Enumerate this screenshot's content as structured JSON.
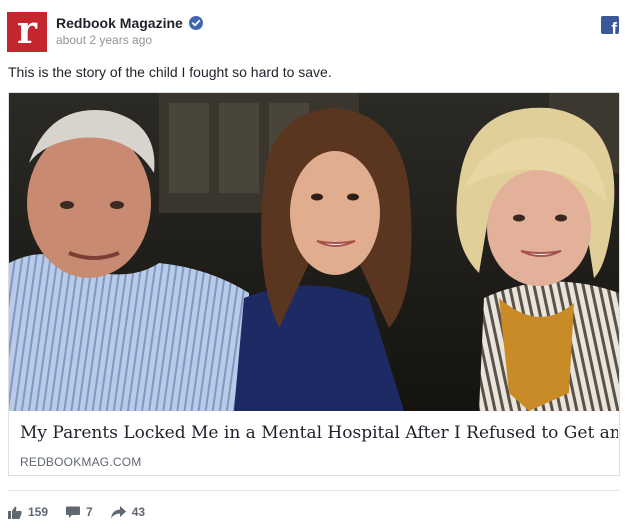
{
  "post": {
    "page_name": "Redbook Magazine",
    "avatar_letter": "r",
    "timestamp": "about 2 years ago",
    "text": "This is the story of the child I fought so hard to save."
  },
  "link": {
    "headline": "My Parents Locked Me in a Mental Hospital After I Refused to Get an Abortion",
    "domain": "REDBOOKMAG.COM"
  },
  "engagement": {
    "likes": "159",
    "comments": "7",
    "shares": "43"
  },
  "colors": {
    "brand": "#c4262e",
    "facebook": "#3b5998",
    "verified": "#4267b2",
    "meta_text": "#90949c",
    "icon": "#606770"
  },
  "icons": {
    "verified": "verified-badge-icon",
    "facebook": "facebook-logo-icon",
    "like": "thumbs-up-icon",
    "comment": "speech-bubble-icon",
    "share": "share-arrow-icon"
  }
}
